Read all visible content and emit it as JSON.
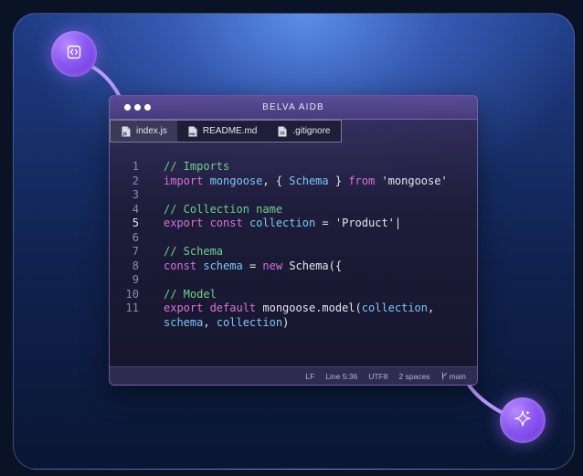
{
  "window": {
    "title": "BELVA AIDB"
  },
  "tabs": [
    {
      "label": "index.js",
      "icon": "js-file-icon",
      "active": true
    },
    {
      "label": "README.md",
      "icon": "markdown-file-icon",
      "active": false
    },
    {
      "label": ".gitignore",
      "icon": "file-icon",
      "active": false
    }
  ],
  "code": {
    "line_numbers": [
      "1",
      "2",
      "3",
      "4",
      "5",
      "6",
      "7",
      "8",
      "9",
      "10",
      "11"
    ],
    "current_line": "5",
    "lines": [
      [
        {
          "t": "// Imports",
          "c": "cm"
        }
      ],
      [
        {
          "t": "import ",
          "c": "kw"
        },
        {
          "t": "mongoose",
          "c": "id"
        },
        {
          "t": ", { ",
          "c": "pl"
        },
        {
          "t": "Schema",
          "c": "id"
        },
        {
          "t": " } ",
          "c": "pl"
        },
        {
          "t": "from ",
          "c": "kw"
        },
        {
          "t": "'mongoose'",
          "c": "st"
        }
      ],
      [],
      [
        {
          "t": "// Collection name",
          "c": "cm"
        }
      ],
      [
        {
          "t": "export ",
          "c": "kw"
        },
        {
          "t": "const ",
          "c": "kw"
        },
        {
          "t": "collection",
          "c": "id"
        },
        {
          "t": " = ",
          "c": "pl"
        },
        {
          "t": "'Product'|",
          "c": "st"
        }
      ],
      [],
      [
        {
          "t": "// Schema",
          "c": "cm"
        }
      ],
      [
        {
          "t": "const ",
          "c": "kw"
        },
        {
          "t": "schema",
          "c": "id"
        },
        {
          "t": " = ",
          "c": "pl"
        },
        {
          "t": "new ",
          "c": "kw"
        },
        {
          "t": "Schema({",
          "c": "pl"
        }
      ],
      [],
      [
        {
          "t": "// Model",
          "c": "cm"
        }
      ],
      [
        {
          "t": "export ",
          "c": "kw"
        },
        {
          "t": "default ",
          "c": "kw"
        },
        {
          "t": "mongoose.model(",
          "c": "pl"
        },
        {
          "t": "collection",
          "c": "id"
        },
        {
          "t": ",",
          "c": "pl"
        }
      ],
      [
        {
          "t": "schema",
          "c": "id"
        },
        {
          "t": ", ",
          "c": "pl"
        },
        {
          "t": "collection",
          "c": "id"
        },
        {
          "t": ")",
          "c": "pl"
        }
      ]
    ]
  },
  "status": {
    "line_ending": "LF",
    "position": "Line 5:36",
    "encoding": "UTF8",
    "indent": "2 spaces",
    "branch": "main"
  },
  "colors": {
    "comment": "#6fd08a",
    "keyword": "#d873d8",
    "identifier": "#7cc6f5",
    "orb": "#8a55f0"
  },
  "icons": {
    "top_orb": "code-brackets-icon",
    "bottom_orb": "sparkle-icon",
    "branch": "git-branch-icon"
  }
}
